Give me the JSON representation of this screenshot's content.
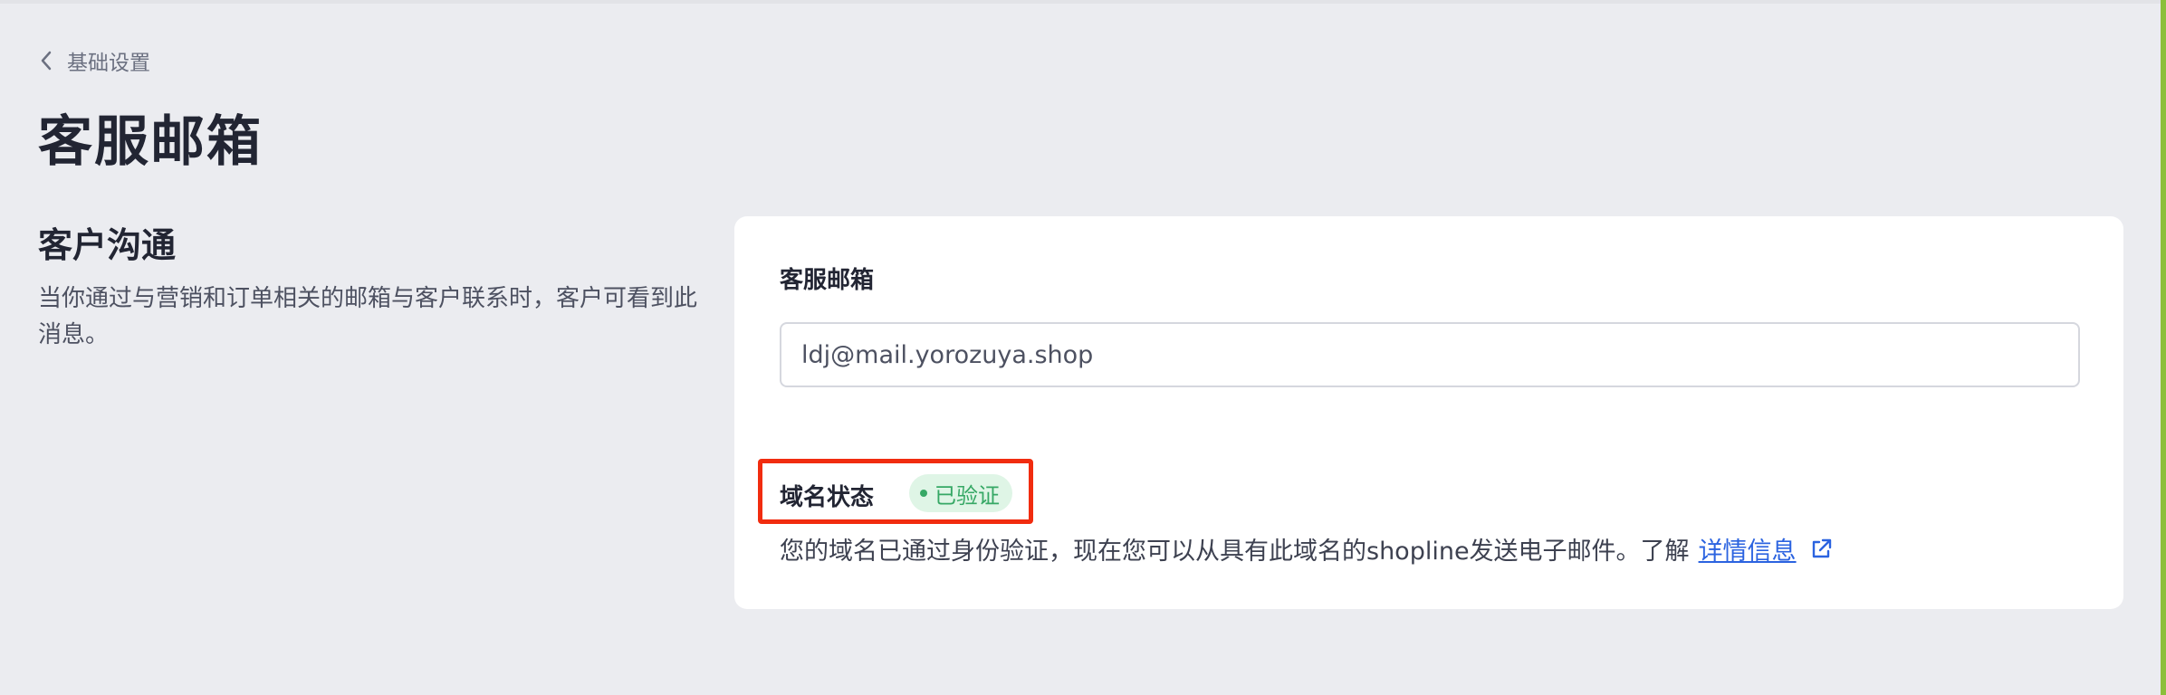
{
  "breadcrumb": {
    "back_label": "基础设置"
  },
  "page": {
    "title": "客服邮箱"
  },
  "section": {
    "heading": "客户沟通",
    "description": "当你通过与营销和订单相关的邮箱与客户联系时，客户可看到此消息。"
  },
  "card": {
    "email_label": "客服邮箱",
    "email_value": "ldj@mail.yorozuya.shop",
    "domain_status_label": "域名状态",
    "domain_status_badge": "已验证",
    "domain_description": "您的域名已通过身份验证，现在您可以从具有此域名的shopline发送电子邮件。了解",
    "details_link": "详情信息"
  },
  "colors": {
    "background": "#ebecf0",
    "card": "#ffffff",
    "accent_bar": "#8bbf3a",
    "link": "#2b63e0",
    "verified_text": "#36a865",
    "verified_bg": "#dff5e6",
    "highlight": "#f12c0f"
  },
  "icons": {
    "back": "chevron-left-icon",
    "external": "external-link-icon"
  }
}
